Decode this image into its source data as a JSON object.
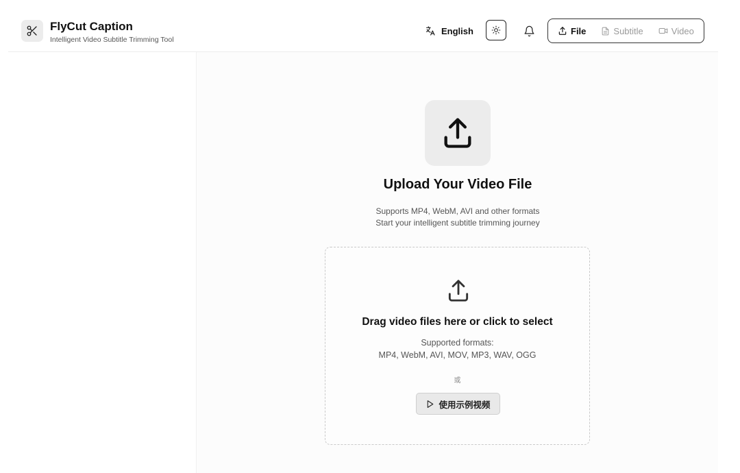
{
  "header": {
    "app_title": "FlyCut Caption",
    "app_subtitle": "Intelligent Video Subtitle Trimming Tool",
    "logo_icon": "scissors-icon",
    "language_label": "English",
    "language_icon": "translate-icon",
    "theme_icon": "sun-icon",
    "notification_icon": "bell-icon",
    "steps": [
      {
        "label": "File",
        "icon": "upload-icon",
        "active": true
      },
      {
        "label": "Subtitle",
        "icon": "document-icon",
        "active": false
      },
      {
        "label": "Video",
        "icon": "video-camera-icon",
        "active": false
      }
    ]
  },
  "upload": {
    "title": "Upload Your Video File",
    "desc_line1": "Supports MP4, WebM, AVI and other formats",
    "desc_line2": "Start your intelligent subtitle trimming journey",
    "dropzone": {
      "title": "Drag video files here or click to select",
      "formats_label": "Supported formats:",
      "formats_list": "MP4, WebM, AVI, MOV, MP3, WAV, OGG",
      "or_text": "或",
      "sample_button": "使用示例视频",
      "sample_icon": "play-icon"
    }
  },
  "colors": {
    "text_primary": "#111111",
    "text_secondary": "#555555",
    "muted": "#9a9a9a",
    "icon_tile": "#ececec"
  }
}
